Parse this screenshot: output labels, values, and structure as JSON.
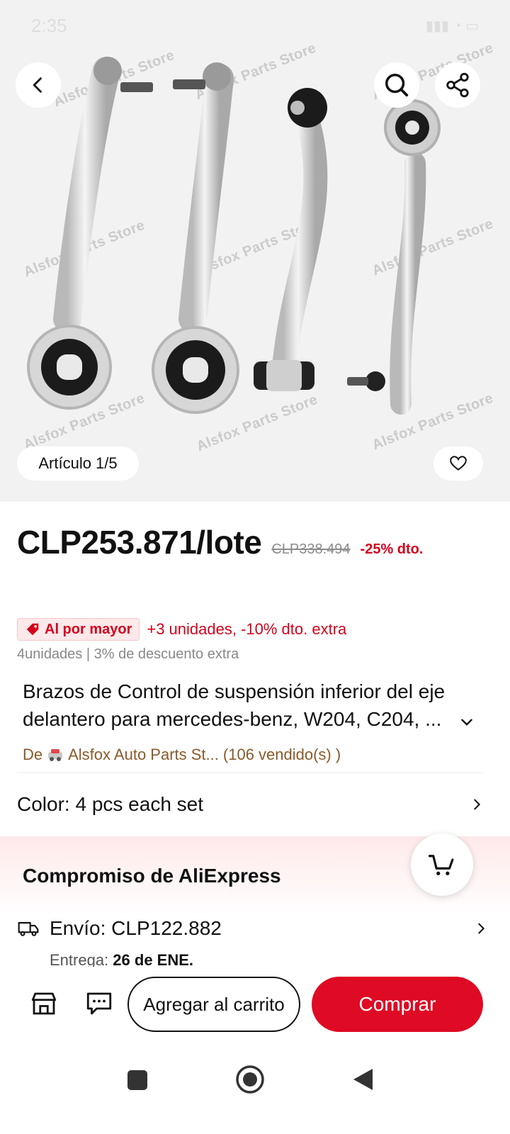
{
  "status_bar": {
    "time": "2:35"
  },
  "hero": {
    "watermark_text": "Alsfox Parts Store",
    "counter_label": "Artículo 1/5"
  },
  "icons": {
    "back": "chevron-left-icon",
    "search": "search-icon",
    "share": "share-icon",
    "wishlist": "heart-icon",
    "store": "store-icon",
    "chat": "chat-icon",
    "cart": "cart-icon",
    "shipping": "truck-icon"
  },
  "price": {
    "current": "CLP253.871/lote",
    "original": "CLP338.494",
    "discount": "-25% dto."
  },
  "bulk": {
    "badge": "Al por mayor",
    "offer": "+3 unidades, -10% dto. extra",
    "sub": "4unidades | 3% de descuento extra"
  },
  "product": {
    "title": "Brazos de Control de suspensión inferior del eje delantero para mercedes-benz, W204, C204, ..."
  },
  "seller": {
    "prefix": "De",
    "name": "Alsfox Auto Parts St...",
    "sold": "(106 vendido(s) )"
  },
  "variant": {
    "label": "Color: 4 pcs each set"
  },
  "commitment": {
    "title": "Compromiso de AliExpress"
  },
  "shipping": {
    "cost": "Envío: CLP122.882",
    "delivery_label": "Entrega:",
    "delivery_date": "26 de ENE."
  },
  "actions": {
    "add_to_cart": "Agregar al carrito",
    "buy": "Comprar"
  },
  "colors": {
    "accent": "#df0a24",
    "discount": "#d3031c",
    "seller": "#8a5a2b"
  }
}
